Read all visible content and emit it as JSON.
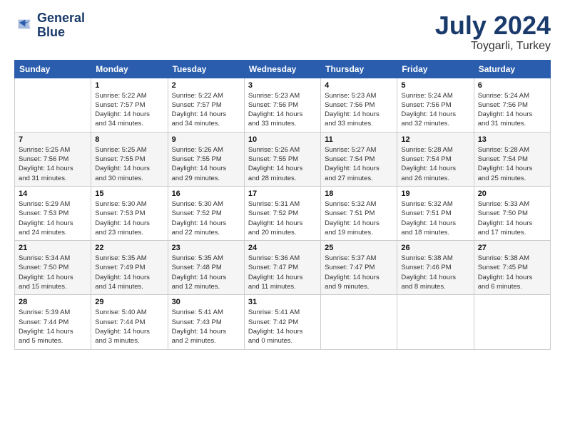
{
  "header": {
    "logo_line1": "General",
    "logo_line2": "Blue",
    "title": "July 2024",
    "subtitle": "Toygarli, Turkey"
  },
  "days_of_week": [
    "Sunday",
    "Monday",
    "Tuesday",
    "Wednesday",
    "Thursday",
    "Friday",
    "Saturday"
  ],
  "weeks": [
    [
      {
        "day": "",
        "info": ""
      },
      {
        "day": "1",
        "info": "Sunrise: 5:22 AM\nSunset: 7:57 PM\nDaylight: 14 hours\nand 34 minutes."
      },
      {
        "day": "2",
        "info": "Sunrise: 5:22 AM\nSunset: 7:57 PM\nDaylight: 14 hours\nand 34 minutes."
      },
      {
        "day": "3",
        "info": "Sunrise: 5:23 AM\nSunset: 7:56 PM\nDaylight: 14 hours\nand 33 minutes."
      },
      {
        "day": "4",
        "info": "Sunrise: 5:23 AM\nSunset: 7:56 PM\nDaylight: 14 hours\nand 33 minutes."
      },
      {
        "day": "5",
        "info": "Sunrise: 5:24 AM\nSunset: 7:56 PM\nDaylight: 14 hours\nand 32 minutes."
      },
      {
        "day": "6",
        "info": "Sunrise: 5:24 AM\nSunset: 7:56 PM\nDaylight: 14 hours\nand 31 minutes."
      }
    ],
    [
      {
        "day": "7",
        "info": "Sunrise: 5:25 AM\nSunset: 7:56 PM\nDaylight: 14 hours\nand 31 minutes."
      },
      {
        "day": "8",
        "info": "Sunrise: 5:25 AM\nSunset: 7:55 PM\nDaylight: 14 hours\nand 30 minutes."
      },
      {
        "day": "9",
        "info": "Sunrise: 5:26 AM\nSunset: 7:55 PM\nDaylight: 14 hours\nand 29 minutes."
      },
      {
        "day": "10",
        "info": "Sunrise: 5:26 AM\nSunset: 7:55 PM\nDaylight: 14 hours\nand 28 minutes."
      },
      {
        "day": "11",
        "info": "Sunrise: 5:27 AM\nSunset: 7:54 PM\nDaylight: 14 hours\nand 27 minutes."
      },
      {
        "day": "12",
        "info": "Sunrise: 5:28 AM\nSunset: 7:54 PM\nDaylight: 14 hours\nand 26 minutes."
      },
      {
        "day": "13",
        "info": "Sunrise: 5:28 AM\nSunset: 7:54 PM\nDaylight: 14 hours\nand 25 minutes."
      }
    ],
    [
      {
        "day": "14",
        "info": "Sunrise: 5:29 AM\nSunset: 7:53 PM\nDaylight: 14 hours\nand 24 minutes."
      },
      {
        "day": "15",
        "info": "Sunrise: 5:30 AM\nSunset: 7:53 PM\nDaylight: 14 hours\nand 23 minutes."
      },
      {
        "day": "16",
        "info": "Sunrise: 5:30 AM\nSunset: 7:52 PM\nDaylight: 14 hours\nand 22 minutes."
      },
      {
        "day": "17",
        "info": "Sunrise: 5:31 AM\nSunset: 7:52 PM\nDaylight: 14 hours\nand 20 minutes."
      },
      {
        "day": "18",
        "info": "Sunrise: 5:32 AM\nSunset: 7:51 PM\nDaylight: 14 hours\nand 19 minutes."
      },
      {
        "day": "19",
        "info": "Sunrise: 5:32 AM\nSunset: 7:51 PM\nDaylight: 14 hours\nand 18 minutes."
      },
      {
        "day": "20",
        "info": "Sunrise: 5:33 AM\nSunset: 7:50 PM\nDaylight: 14 hours\nand 17 minutes."
      }
    ],
    [
      {
        "day": "21",
        "info": "Sunrise: 5:34 AM\nSunset: 7:50 PM\nDaylight: 14 hours\nand 15 minutes."
      },
      {
        "day": "22",
        "info": "Sunrise: 5:35 AM\nSunset: 7:49 PM\nDaylight: 14 hours\nand 14 minutes."
      },
      {
        "day": "23",
        "info": "Sunrise: 5:35 AM\nSunset: 7:48 PM\nDaylight: 14 hours\nand 12 minutes."
      },
      {
        "day": "24",
        "info": "Sunrise: 5:36 AM\nSunset: 7:47 PM\nDaylight: 14 hours\nand 11 minutes."
      },
      {
        "day": "25",
        "info": "Sunrise: 5:37 AM\nSunset: 7:47 PM\nDaylight: 14 hours\nand 9 minutes."
      },
      {
        "day": "26",
        "info": "Sunrise: 5:38 AM\nSunset: 7:46 PM\nDaylight: 14 hours\nand 8 minutes."
      },
      {
        "day": "27",
        "info": "Sunrise: 5:38 AM\nSunset: 7:45 PM\nDaylight: 14 hours\nand 6 minutes."
      }
    ],
    [
      {
        "day": "28",
        "info": "Sunrise: 5:39 AM\nSunset: 7:44 PM\nDaylight: 14 hours\nand 5 minutes."
      },
      {
        "day": "29",
        "info": "Sunrise: 5:40 AM\nSunset: 7:44 PM\nDaylight: 14 hours\nand 3 minutes."
      },
      {
        "day": "30",
        "info": "Sunrise: 5:41 AM\nSunset: 7:43 PM\nDaylight: 14 hours\nand 2 minutes."
      },
      {
        "day": "31",
        "info": "Sunrise: 5:41 AM\nSunset: 7:42 PM\nDaylight: 14 hours\nand 0 minutes."
      },
      {
        "day": "",
        "info": ""
      },
      {
        "day": "",
        "info": ""
      },
      {
        "day": "",
        "info": ""
      }
    ]
  ]
}
